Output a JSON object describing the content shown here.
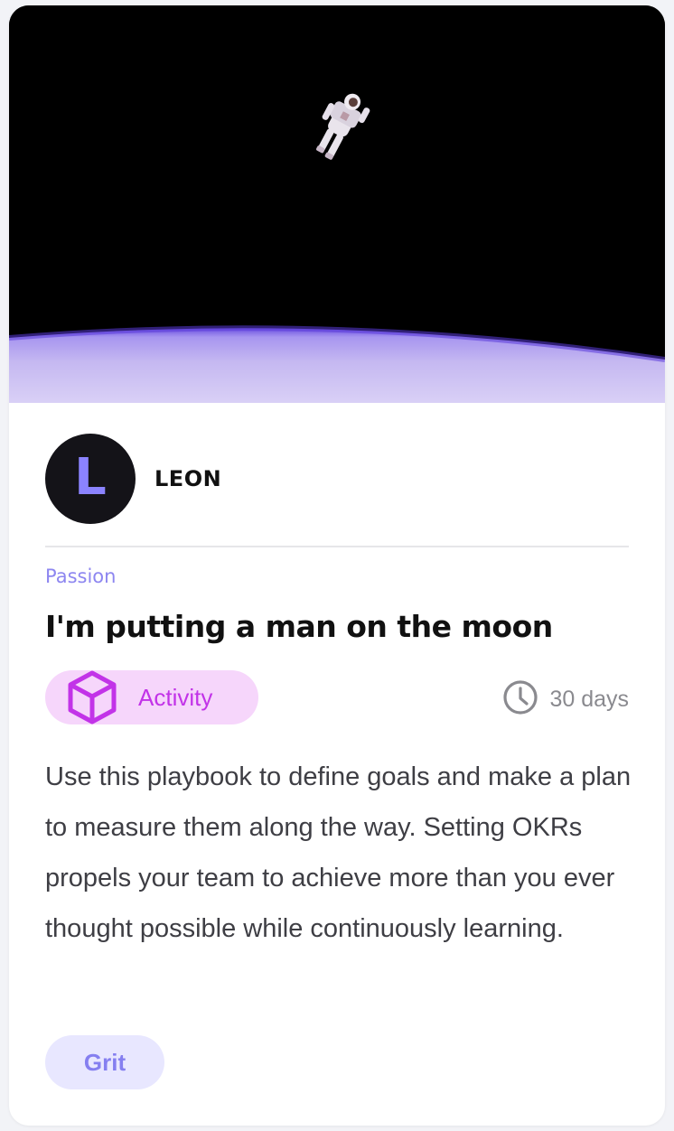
{
  "author": {
    "initial": "L",
    "name": "LEON"
  },
  "category": "Passion",
  "title": "I'm putting a man on the moon",
  "activity": {
    "label": "Activity",
    "icon": "cube-icon"
  },
  "duration": {
    "icon": "clock-icon",
    "text": "30 days"
  },
  "description": "Use this playbook to define goals and make a plan to measure them along the way. Setting OKRs propels your team to achieve more than you ever thought possible while continuously learning.",
  "tag": "Grit",
  "colors": {
    "accent": "#8b83ff",
    "activity_bg": "#f6d6fb",
    "activity_fg": "#c233e8",
    "tag_bg": "#e8e7ff",
    "tag_fg": "#857ff0"
  }
}
